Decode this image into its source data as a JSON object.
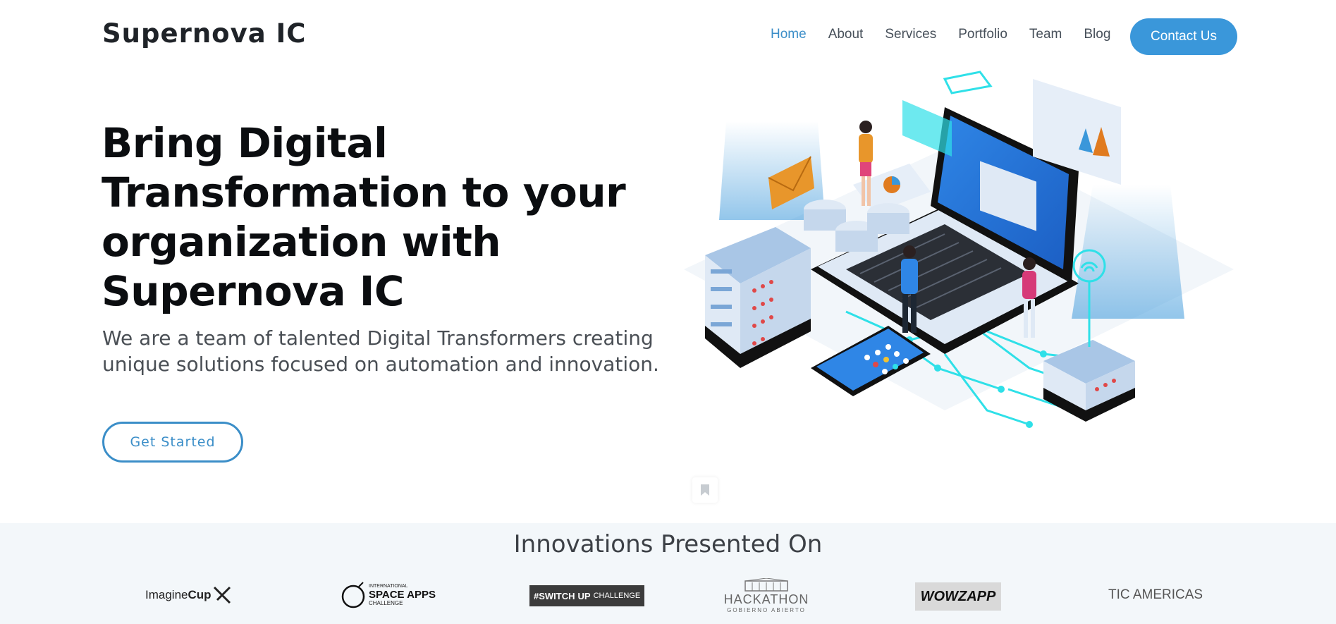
{
  "header": {
    "brand": "Supernova IC",
    "nav": [
      "Home",
      "About",
      "Services",
      "Portfolio",
      "Team",
      "Blog"
    ],
    "active_nav": "Home",
    "contact_label": "Contact Us"
  },
  "hero": {
    "title_lines": [
      "Bring Digital",
      "Transformation to your",
      "organization with",
      "Supernova IC"
    ],
    "subtitle_lines": [
      "We are a team of talented Digital Transformers creating",
      "unique solutions focused on automation and innovation."
    ],
    "cta_label": "Get Started"
  },
  "innovations": {
    "title": "Innovations Presented On",
    "logos": [
      {
        "name": "imagine-cup",
        "text_a": "Imagine",
        "text_b": "Cup"
      },
      {
        "name": "space-apps",
        "text_a": "SPACE APPS",
        "text_b": "CHALLENGE",
        "text_c": "INTERNATIONAL"
      },
      {
        "name": "switch-up",
        "text_a": "#SWITCH",
        "text_b": "UP",
        "text_c": "CHALLENGE"
      },
      {
        "name": "hackathon",
        "text_a": "HACKATHON",
        "text_b": "GOBIERNO ABIERTO"
      },
      {
        "name": "wowzapp",
        "text_a": "WOWZAPP"
      },
      {
        "name": "tic-americas",
        "text_a": "TIC AMERICAS"
      }
    ]
  },
  "colors": {
    "accent": "#3a97da",
    "nav_active": "#3b8ec8",
    "band_bg": "#f3f7fa"
  }
}
